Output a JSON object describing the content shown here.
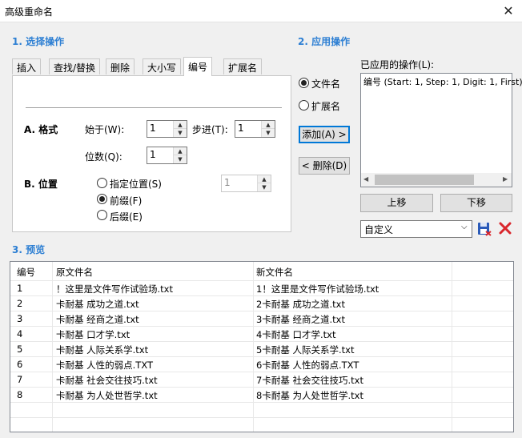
{
  "window": {
    "title": "高级重命名"
  },
  "section1": {
    "title": "1. 选择操作"
  },
  "section2": {
    "title": "2. 应用操作"
  },
  "section3": {
    "title": "3. 预览"
  },
  "tabs": [
    "插入",
    "查找/替换",
    "删除",
    "大小写",
    "编号",
    "扩展名"
  ],
  "active_tab": "编号",
  "format": {
    "label": "A. 格式",
    "start_label": "始于(W):",
    "start_value": "1",
    "step_label": "步进(T):",
    "step_value": "1",
    "digits_label": "位数(Q):",
    "digits_value": "1"
  },
  "position": {
    "label": "B. 位置",
    "options": [
      "指定位置(S)",
      "前缀(F)",
      "后缀(E)"
    ],
    "selected": "前缀(F)",
    "position_value": "1"
  },
  "apply": {
    "targets": [
      "文件名",
      "扩展名"
    ],
    "selected_target": "文件名",
    "add_button": "添加(A) >",
    "remove_button": "< 删除(D)",
    "applied_label": "已应用的操作(L):",
    "applied_items": [
      "编号 (Start: 1, Step: 1, Digit: 1, First)"
    ],
    "move_up": "上移",
    "move_down": "下移",
    "preset_value": "自定义"
  },
  "preview": {
    "columns": [
      "编号",
      "原文件名",
      "新文件名"
    ],
    "rows": [
      [
        "1",
        "！这里是文件写作试验场.txt",
        "1！这里是文件写作试验场.txt"
      ],
      [
        "2",
        "卡耐基 成功之道.txt",
        "2卡耐基 成功之道.txt"
      ],
      [
        "3",
        "卡耐基 经商之道.txt",
        "3卡耐基 经商之道.txt"
      ],
      [
        "4",
        "卡耐基 口才学.txt",
        "4卡耐基 口才学.txt"
      ],
      [
        "5",
        "卡耐基 人际关系学.txt",
        "5卡耐基 人际关系学.txt"
      ],
      [
        "6",
        "卡耐基 人性的弱点.TXT",
        "6卡耐基 人性的弱点.TXT"
      ],
      [
        "7",
        "卡耐基 社会交往技巧.txt",
        "7卡耐基 社会交往技巧.txt"
      ],
      [
        "8",
        "卡耐基 为人处世哲学.txt",
        "8卡耐基 为人处世哲学.txt"
      ]
    ]
  },
  "colors": {
    "section_title": "#2d7fd3",
    "focus_border": "#0078d7",
    "delete_icon": "#d9262c",
    "save_icon": "#2a5ab8"
  }
}
